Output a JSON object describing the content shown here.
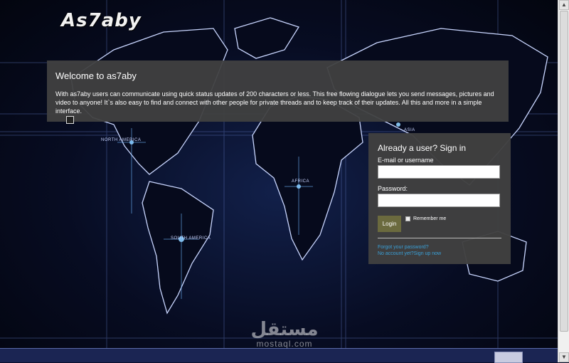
{
  "brand": {
    "logo_text": "As7aby"
  },
  "welcome": {
    "title": "Welcome to as7aby",
    "body": "With as7aby users can communicate using quick status updates of 200 characters or less. This free flowing dialogue lets you send messages, pictures and video to anyone! It`s also easy to find and connect with other people for private threads and to keep track of their updates. All this and more in a simple interface."
  },
  "map_labels": {
    "north_america": "NORTH AMERICA",
    "south_america": "SOUTH AMERICA",
    "africa": "AFRICA",
    "asia": "ASIA"
  },
  "signin": {
    "heading": "Already a user? Sign in",
    "email_label": "E-mail or username",
    "email_value": "",
    "password_label": "Password:",
    "password_value": "",
    "login_button": "Login",
    "remember_label": "Remember me",
    "forgot_link": "Forgot your password?",
    "signup_link": "No account yet?Sign up now"
  },
  "watermark": {
    "arabic": "مستقل",
    "latin": "mostaql.com"
  },
  "colors": {
    "panel": "#404040",
    "login_button": "#6b6a3e",
    "link": "#3aa0d8",
    "footer": "#1b2553"
  }
}
